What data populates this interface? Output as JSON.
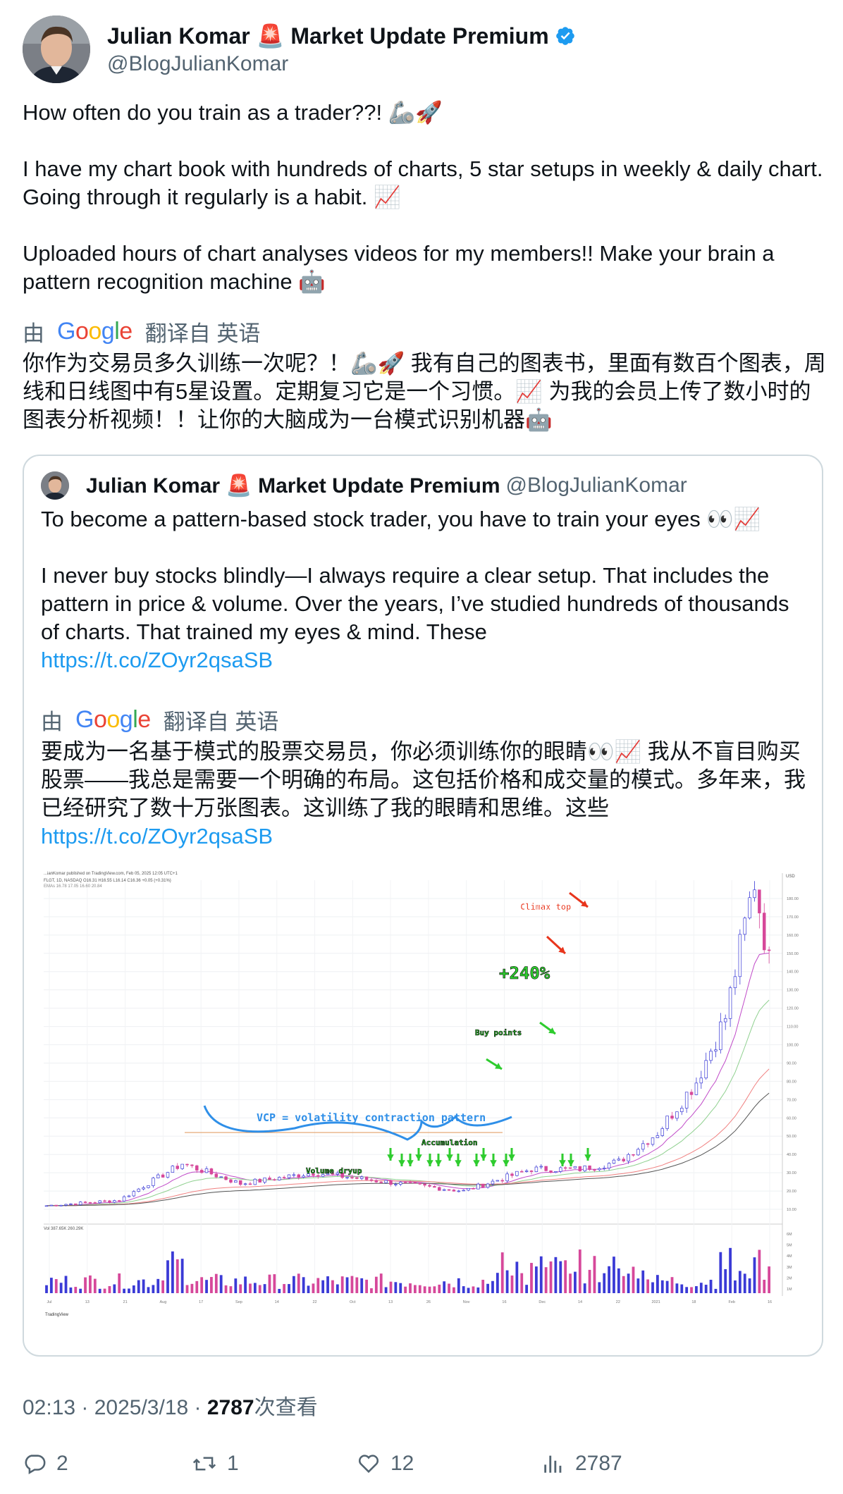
{
  "author": {
    "display_name": "Julian Komar 🚨 Market Update Premium",
    "handle": "@BlogJulianKomar"
  },
  "tweet": {
    "paragraphs": [
      "How often do you train as a trader??! 🦾🚀",
      "I have my chart book with hundreds of charts, 5 star setups in weekly & daily chart. Going through it regularly is a habit. 📈",
      "Uploaded hours of chart analyses videos for my members!! Make your brain a pattern recognition machine 🤖"
    ],
    "translate_prefix": "由",
    "translate_brand": "Google",
    "translate_suffix": "翻译自 英语",
    "translated_text": "你作为交易员多久训练一次呢？！🦾🚀 我有自己的图表书，里面有数百个图表，周线和日线图中有5星设置。定期复习它是一个习惯。📈 为我的会员上传了数小时的图表分析视频！！让你的大脑成为一台模式识别机器🤖"
  },
  "quoted": {
    "display_name": "Julian Komar 🚨 Market Update Premium",
    "handle": "@BlogJulianKomar",
    "p1": "To become a pattern-based stock trader, you have to train your eyes 👀📈",
    "p2": "I never buy stocks blindly—I always require a clear setup. That includes the pattern in price & volume. Over the years, I’ve studied hundreds of thousands of charts. That trained my eyes & mind. These",
    "link": "https://t.co/ZOyr2qsaSB",
    "translate_prefix": "由",
    "translate_brand": "Google",
    "translate_suffix": "翻译自 英语",
    "translated_text": "要成为一名基于模式的股票交易员，你必须训练你的眼睛👀📈 我从不盲目购买股票——我总是需要一个明确的布局。这包括价格和成交量的模式。多年来，我已经研究了数十万张图表。这训练了我的眼睛和思维。这些",
    "translated_link": "https://t.co/ZOyr2qsaSB"
  },
  "chart_data": {
    "type": "candlestick",
    "header_line": "...ianKomar published on TradingView.com, Feb 05, 2025 12:05 UTC+1",
    "ticker_line": "FLGT, 1D, NASDAQ  O16.31 H16.55 L16.14 C16.36 +0.05 (+0.31%)",
    "ema_line": "EMAs  16.78  17.05  16.60  20.84",
    "volume_label": "Vol  387.65K  260.29K",
    "currency": "USD",
    "y_ticks": [
      180,
      170,
      160,
      150,
      140,
      130,
      120,
      110,
      100,
      90,
      80,
      70,
      60,
      50,
      40,
      30,
      20,
      10
    ],
    "x_ticks": [
      "Jul",
      "13",
      "21",
      "Aug",
      "17",
      "Sep",
      "14",
      "22",
      "Oct",
      "13",
      "26",
      "Nov",
      "16",
      "Dec",
      "14",
      "22",
      "2021",
      "18",
      "Feb",
      "16"
    ],
    "vol_ticks": [
      "6M",
      "5M",
      "4M",
      "3M",
      "2M",
      "1M"
    ],
    "annotations": {
      "climax": "Climax top",
      "gain": "+240%",
      "buy": "Buy points",
      "vcp": "VCP = volatility contraction pattern",
      "accumulation": "Accumulation",
      "dryup": "Volume dryup",
      "brand": "TradingView"
    },
    "colors": {
      "up": "#3a3ad6",
      "down": "#d6489a",
      "vcp": "#2f8fe8",
      "arrow_red": "#e8351c",
      "arrow_green": "#2ecc2e"
    }
  },
  "meta": {
    "time": "02:13 · 2025/3/18 · ",
    "views_count": "2787",
    "views_label": "次查看"
  },
  "actions": {
    "replies": "2",
    "retweets": "1",
    "likes": "12",
    "views": "2787"
  }
}
